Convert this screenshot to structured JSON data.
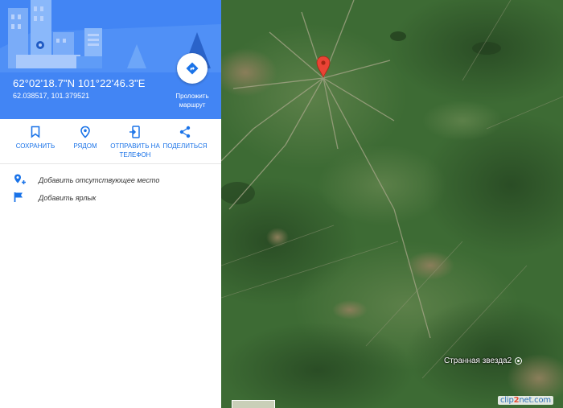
{
  "place": {
    "coordinates_dms": "62°02'18.7\"N 101°22'46.3\"E",
    "coordinates_decimal": "62.038517, 101.379521"
  },
  "route": {
    "label": "Проложить маршрут",
    "icon": "directions-icon"
  },
  "actions": [
    {
      "label": "СОХРАНИТЬ",
      "icon": "bookmark-icon"
    },
    {
      "label": "РЯДОМ",
      "icon": "nearby-icon"
    },
    {
      "label": "ОТПРАВИТЬ НА ТЕЛЕФОН",
      "icon": "send-to-phone-icon"
    },
    {
      "label": "ПОДЕЛИТЬСЯ",
      "icon": "share-icon"
    }
  ],
  "list": [
    {
      "label": "Добавить отсутствующее место",
      "icon": "add-place-icon"
    },
    {
      "label": "Добавить ярлык",
      "icon": "flag-icon"
    }
  ],
  "map": {
    "place_label": "Странная звезда2",
    "watermark_prefix": "clip",
    "watermark_accent": "2",
    "watermark_suffix": "net.com"
  },
  "colors": {
    "panel_blue": "#4285f4",
    "action_blue": "#1a73e8",
    "marker_red": "#ea4335",
    "satellite_green": "#3d6b34"
  }
}
